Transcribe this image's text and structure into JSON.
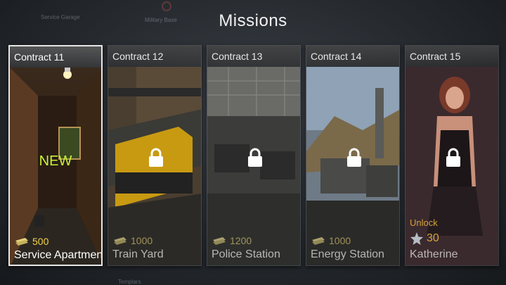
{
  "screen_title": "Missions",
  "background_labels": [
    "Service Garage",
    "Military Base",
    "Templars"
  ],
  "contracts": [
    {
      "contract_label": "Contract 11",
      "location": "Service Apartment",
      "cost": "500",
      "badge": "NEW",
      "locked": false
    },
    {
      "contract_label": "Contract 12",
      "location": "Train Yard",
      "cost": "1000",
      "locked": true
    },
    {
      "contract_label": "Contract 13",
      "location": "Police Station",
      "cost": "1200",
      "locked": true
    },
    {
      "contract_label": "Contract 14",
      "location": "Energy Station",
      "cost": "1000",
      "locked": true
    },
    {
      "contract_label": "Contract 15",
      "location": "Katherine",
      "unlock_label": "Unlock",
      "star_cost": "30",
      "locked": true
    }
  ],
  "icons": {
    "lock": "lock-icon",
    "money": "money-stack-icon",
    "star": "star-icon"
  },
  "colors": {
    "new_badge": "#c7f23a",
    "cost_text": "#f2d24a",
    "unlock_text": "#d6a23c"
  }
}
